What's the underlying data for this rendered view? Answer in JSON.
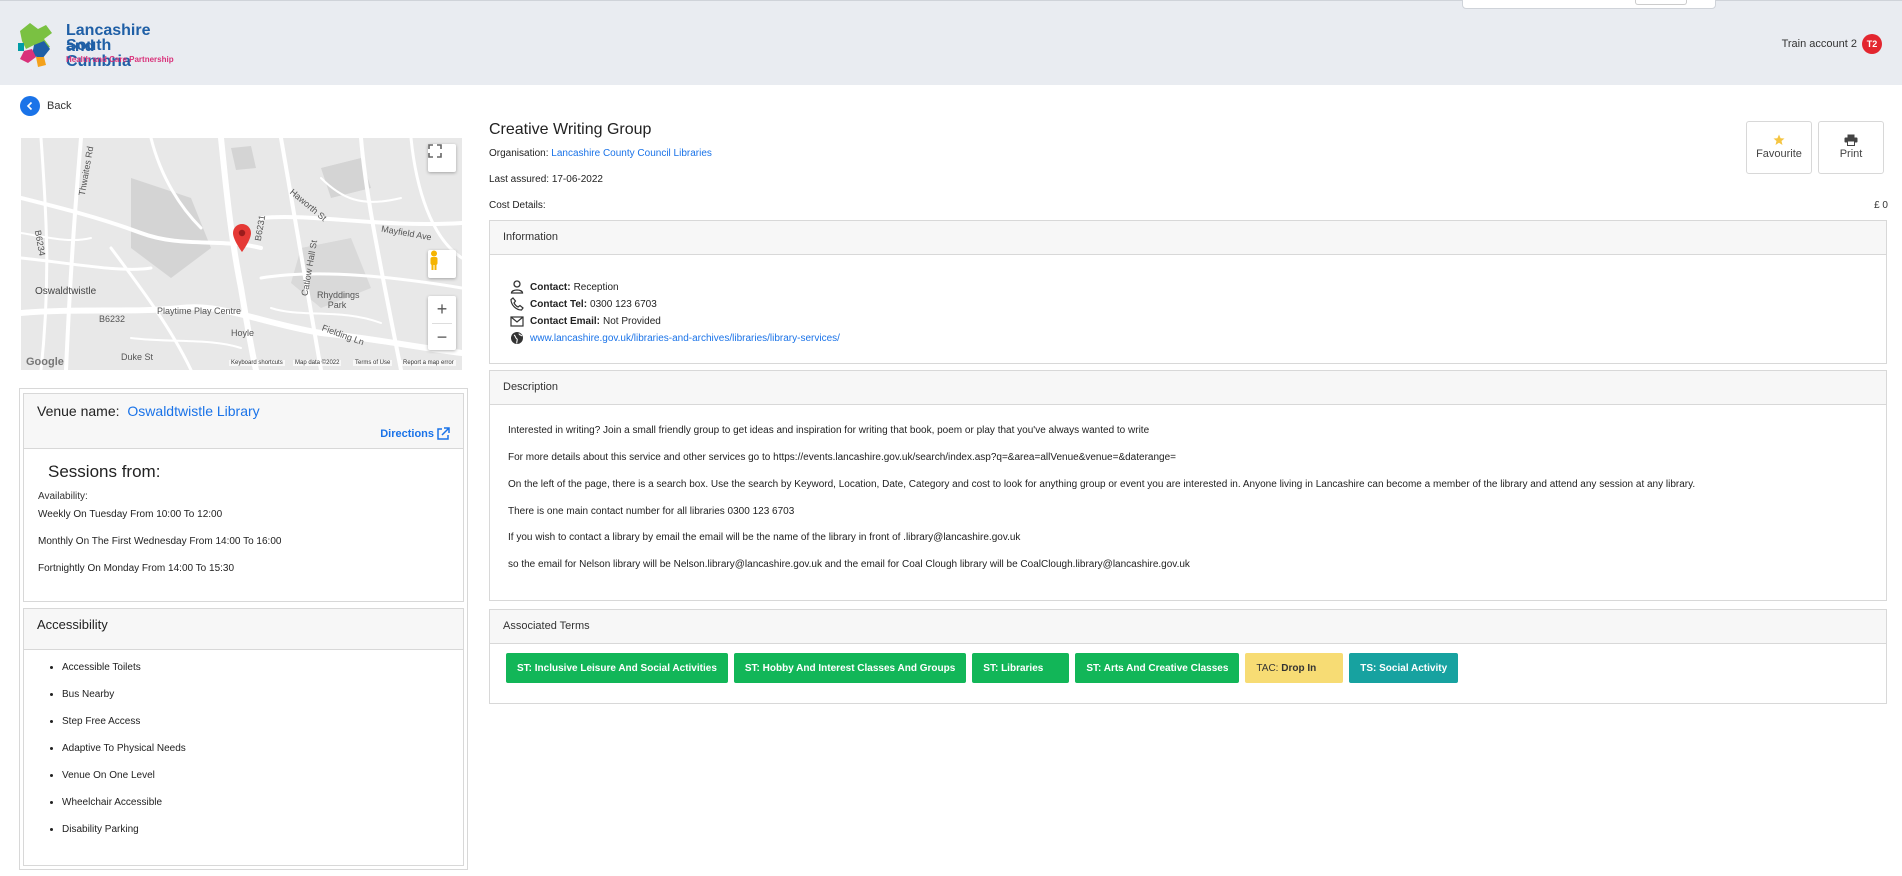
{
  "header": {
    "logo_line1": "Lancashire and",
    "logo_line2": "South Cumbria",
    "logo_line3": "Health and Care Partnership",
    "account_name": "Train account 2",
    "account_initials": "T2"
  },
  "back_label": "Back",
  "map": {
    "labels": [
      "Oswaldtwistle",
      "Playtime Play Centre",
      "Rhyddings Park",
      "Haworth St",
      "Catlow Hall St",
      "Fielding Ln",
      "B6231",
      "B6234",
      "B6232",
      "Thwaites Rd",
      "Mayfield Ave",
      "Duke St",
      "Hoyle"
    ],
    "footer_shortcuts": "Keyboard shortcuts",
    "footer_data": "Map data ©2022",
    "footer_terms": "Terms of Use",
    "footer_report": "Report a map error",
    "google": "Google"
  },
  "venue": {
    "label": "Venue name:",
    "name": "Oswaldtwistle Library",
    "directions": "Directions"
  },
  "sessions": {
    "title": "Sessions from:",
    "availability_label": "Availability:",
    "items": [
      "Weekly On Tuesday From 10:00 To 12:00",
      "Monthly On The First Wednesday From 14:00 To 16:00",
      "Fortnightly On Monday From 14:00 To 15:30"
    ]
  },
  "accessibility": {
    "title": "Accessibility",
    "items": [
      "Accessible Toilets",
      "Bus Nearby",
      "Step Free Access",
      "Adaptive To Physical Needs",
      "Venue On One Level",
      "Wheelchair Accessible",
      "Disability Parking"
    ]
  },
  "service": {
    "title": "Creative Writing Group",
    "org_label": "Organisation:",
    "org_name": "Lancashire County Council Libraries",
    "last_assured": "Last assured: 17-06-2022",
    "cost_label": "Cost Details:",
    "cost_value": "£ 0",
    "favourite_label": "Favourite",
    "print_label": "Print"
  },
  "information": {
    "title": "Information",
    "contact_label": "Contact:",
    "contact_value": "Reception",
    "tel_label": "Contact Tel:",
    "tel_value": "0300 123 6703",
    "email_label": "Contact Email:",
    "email_value": "Not Provided",
    "website": "www.lancashire.gov.uk/libraries-and-archives/libraries/library-services/"
  },
  "description": {
    "title": "Description",
    "lines": [
      "Interested in writing? Join a small friendly group to get ideas and inspiration for writing that book, poem or play that you've always wanted to write",
      "For more details about this service and other services go to https://events.lancashire.gov.uk/search/index.asp?q=&area=allVenue&venue=&daterange=",
      "On the left of the page, there is a search box.  Use the search by Keyword, Location, Date, Category and cost to look for anything group or event you are interested in. Anyone living in Lancashire can become a member of the library and attend any session at any library.",
      "There is one main contact number for all libraries 0300 123 6703",
      "If you wish to contact a library by email the email will be the name of the library in front of  .library@lancashire.gov.uk",
      "so the email for Nelson library will be Nelson.library@lancashire.gov.uk and the email for Coal Clough library will be CoalClough.library@lancashire.gov.uk"
    ]
  },
  "terms": {
    "title": "Associated Terms",
    "tags": [
      {
        "text": "ST: Inclusive Leisure And Social Activities",
        "kind": "green"
      },
      {
        "text": "ST: Hobby And Interest Classes And Groups",
        "kind": "green"
      },
      {
        "text": "ST: Libraries",
        "kind": "green"
      },
      {
        "text": "ST: Arts And Creative Classes",
        "kind": "green"
      },
      {
        "prefix": "TAC:",
        "text": "Drop In",
        "kind": "yellow"
      },
      {
        "text": "TS: Social Activity",
        "kind": "teal"
      }
    ]
  },
  "colors": {
    "accent": "#1a73e8",
    "green": "#12b658",
    "yellow": "#f7dc74",
    "teal": "#17a2a0",
    "account": "#e3262f"
  }
}
